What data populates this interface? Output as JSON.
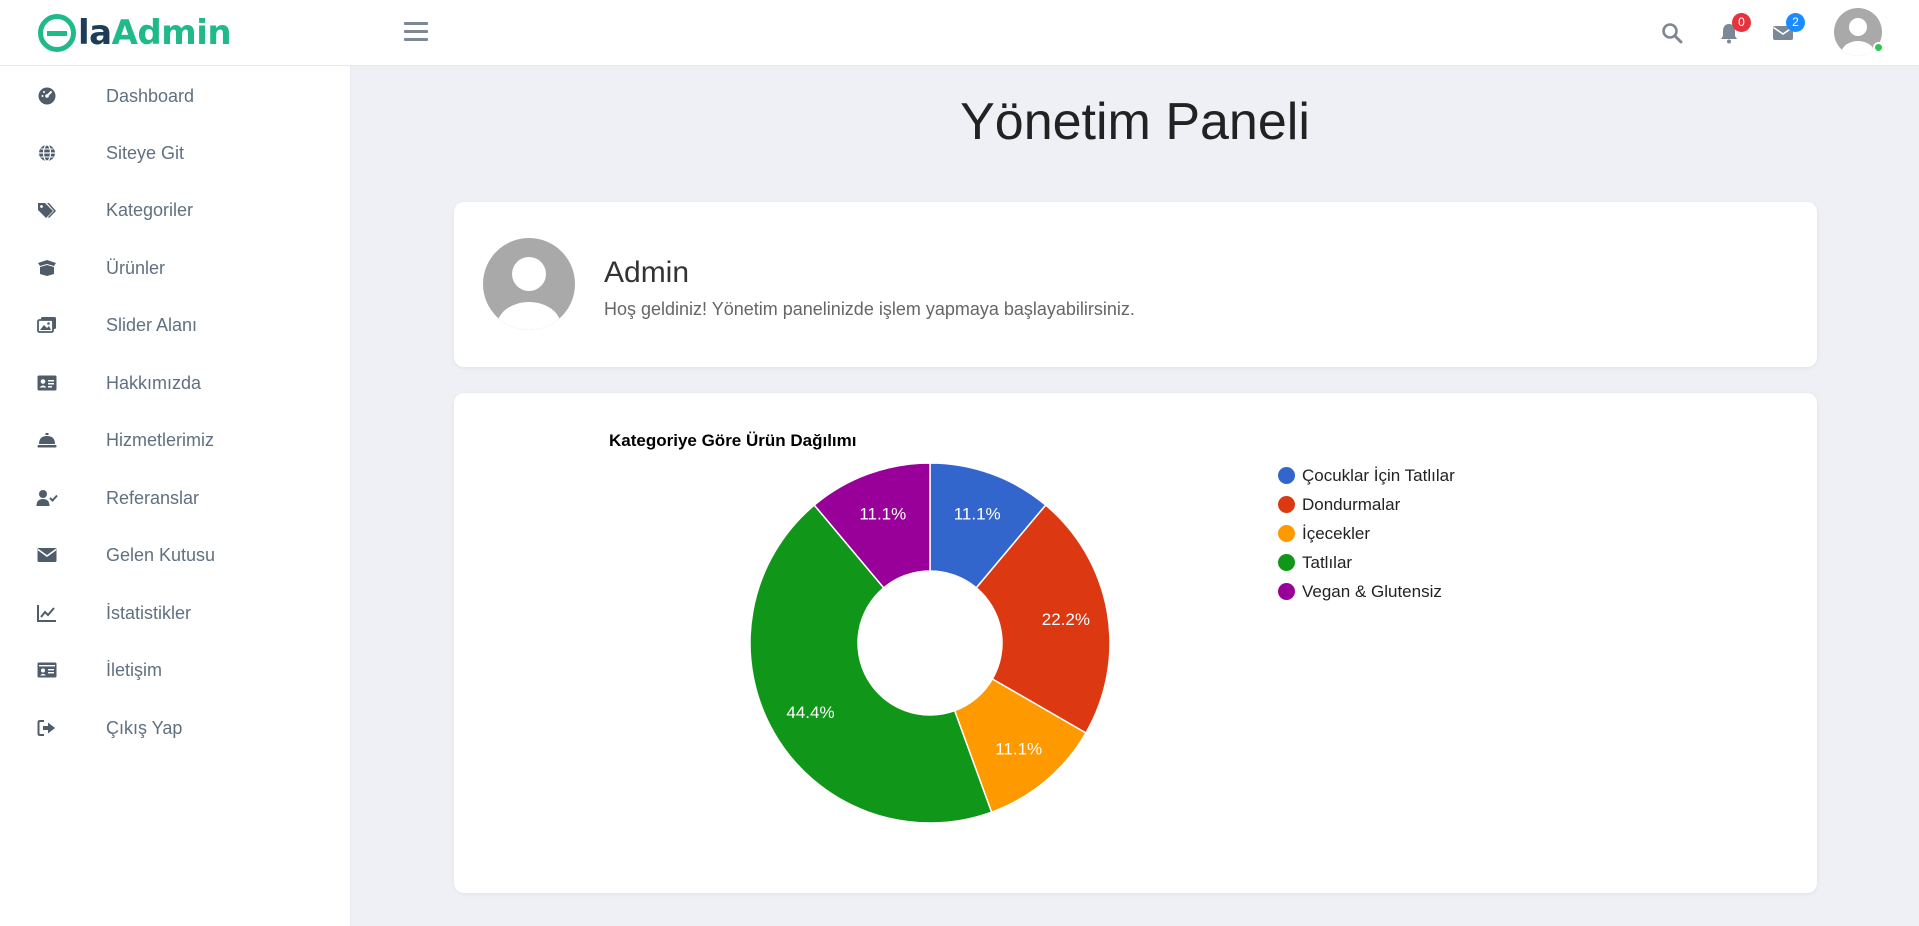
{
  "logo": {
    "e": "",
    "la": "la",
    "admin": "Admin"
  },
  "header": {
    "notifications_count": "0",
    "messages_count": "2"
  },
  "sidebar": {
    "items": [
      {
        "label": "Dashboard",
        "icon": "dashboard-icon"
      },
      {
        "label": "Siteye Git",
        "icon": "globe-icon"
      },
      {
        "label": "Kategoriler",
        "icon": "tags-icon"
      },
      {
        "label": "Ürünler",
        "icon": "box-open-icon"
      },
      {
        "label": "Slider Alanı",
        "icon": "images-icon"
      },
      {
        "label": "Hakkımızda",
        "icon": "id-card-icon"
      },
      {
        "label": "Hizmetlerimiz",
        "icon": "concierge-bell-icon"
      },
      {
        "label": "Referanslar",
        "icon": "user-check-icon"
      },
      {
        "label": "Gelen Kutusu",
        "icon": "envelope-icon"
      },
      {
        "label": "İstatistikler",
        "icon": "chart-line-icon"
      },
      {
        "label": "İletişim",
        "icon": "address-card-icon"
      },
      {
        "label": "Çıkış Yap",
        "icon": "sign-out-icon"
      }
    ]
  },
  "main": {
    "title": "Yönetim Paneli",
    "welcome": {
      "name": "Admin",
      "message": "Hoş geldiniz! Yönetim panelinizde işlem yapmaya başlayabilirsiniz."
    }
  },
  "chart_data": {
    "type": "pie",
    "title": "Kategoriye Göre Ürün Dağılımı",
    "categories": [
      "Çocuklar İçin Tatlılar",
      "Dondurmalar",
      "İçecekler",
      "Tatlılar",
      "Vegan & Glutensiz"
    ],
    "values": [
      11.1,
      22.2,
      11.1,
      44.4,
      11.1
    ],
    "labels": [
      "11.1%",
      "22.2%",
      "11.1%",
      "44.4%",
      "11.1%"
    ],
    "colors": [
      "#3366cc",
      "#dc3912",
      "#ff9900",
      "#109618",
      "#990099"
    ],
    "legend": "right"
  }
}
